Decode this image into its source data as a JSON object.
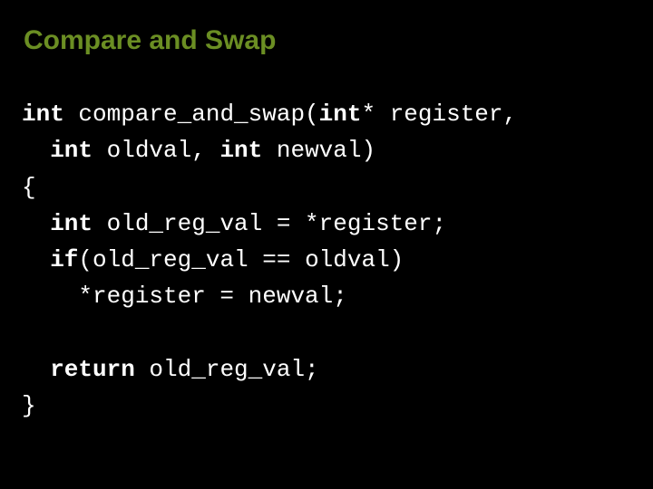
{
  "title": "Compare and Swap",
  "code": {
    "l1a": "int",
    "l1b": " compare_and_swap(",
    "l1c": "int",
    "l1d": "* register,",
    "l2a": "  int",
    "l2b": " oldval, ",
    "l2c": "int",
    "l2d": " newval)",
    "l3": "{",
    "l4a": "  int",
    "l4b": " old_reg_val = *register;",
    "l5a": "  if",
    "l5b": "(old_reg_val == oldval)",
    "l6": "    *register = newval;",
    "l7": "",
    "l8a": "  return",
    "l8b": " old_reg_val;",
    "l9": "}"
  }
}
